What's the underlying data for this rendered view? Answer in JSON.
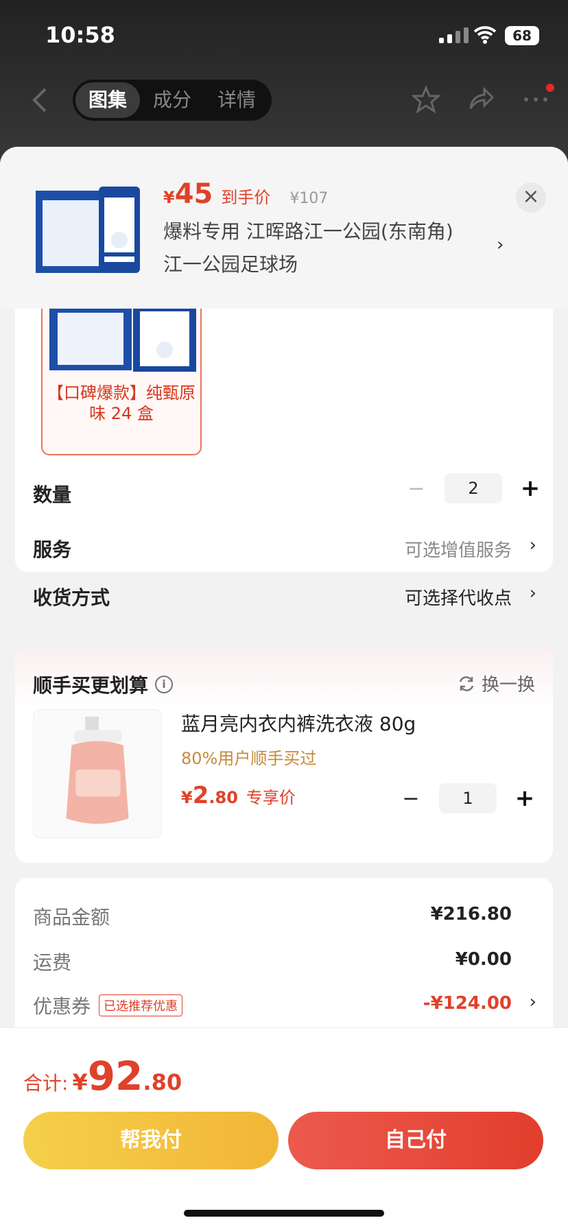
{
  "status_bar": {
    "time": "10:58",
    "battery": "68"
  },
  "nav": {
    "tabs": [
      "图集",
      "成分",
      "详情"
    ],
    "active_tab": 0
  },
  "product_header": {
    "currency": "¥",
    "price": "45",
    "price_tag": "到手价",
    "original_price": "¥107",
    "address_line1": "爆料专用  江晖路江一公园(东南角)",
    "address_line2": "江一公园足球场",
    "close": "×"
  },
  "sku": {
    "label": "【口碑爆款】纯甄原味 24 盒"
  },
  "options": {
    "quantity_label": "数量",
    "quantity": "2",
    "service_label": "服务",
    "service_value": "可选增值服务",
    "delivery_label": "收货方式",
    "delivery_value": "可选择代收点"
  },
  "bundle": {
    "title": "顺手买更划算",
    "swap_label": "换一换",
    "item_name": "蓝月亮内衣内裤洗衣液 80g",
    "item_sub": "80%用户顺手买过",
    "item_currency": "¥",
    "item_price_int": "2",
    "item_price_dec": ".80",
    "item_price_tag": "专享价",
    "item_qty": "1"
  },
  "summary": {
    "goods_label": "商品金额",
    "goods_value": "¥216.80",
    "shipping_label": "运费",
    "shipping_value": "¥0.00",
    "coupon_label": "优惠券",
    "coupon_badge": "已选推荐优惠",
    "coupon_value": "-¥124.00"
  },
  "footer": {
    "total_label": "合计:",
    "total_currency": "¥",
    "total_int": "92",
    "total_dec": ".80",
    "help_pay": "帮我付",
    "self_pay": "自己付"
  },
  "colors": {
    "accent_red": "#e0412a",
    "accent_yellow": "#f2b637"
  }
}
